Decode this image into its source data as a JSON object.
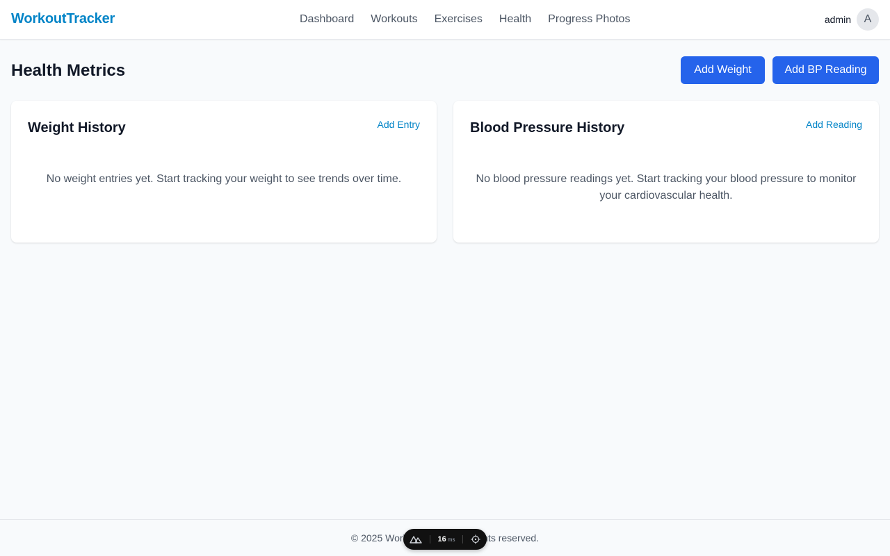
{
  "header": {
    "brand": "WorkoutTracker",
    "nav": [
      "Dashboard",
      "Workouts",
      "Exercises",
      "Health",
      "Progress Photos"
    ],
    "username": "admin",
    "avatar_initial": "A"
  },
  "page": {
    "title": "Health Metrics",
    "add_weight_label": "Add Weight",
    "add_bp_label": "Add BP Reading"
  },
  "weight_card": {
    "title": "Weight History",
    "link_label": "Add Entry",
    "empty_text": "No weight entries yet. Start tracking your weight to see trends over time."
  },
  "bp_card": {
    "title": "Blood Pressure History",
    "link_label": "Add Reading",
    "empty_text": "No blood pressure readings yet. Start tracking your blood pressure to monitor your cardiovascular health."
  },
  "footer": {
    "text": "© 2025 WorkoutTracker. All rights reserved."
  },
  "devtools": {
    "render_time": "16",
    "render_unit": "ms",
    "logo_icon": "nuxt-logo-icon",
    "inspect_icon": "crosshair-icon"
  },
  "colors": {
    "brand": "#0284c7",
    "primary_button": "#2563eb",
    "background": "#f8fafc"
  }
}
